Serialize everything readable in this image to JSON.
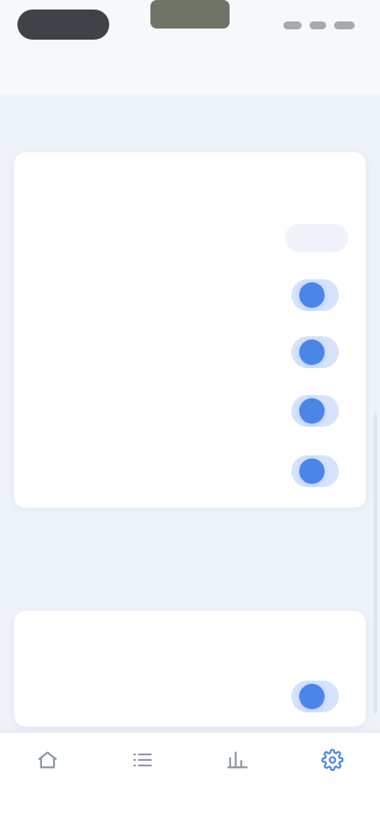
{
  "top": {
    "left_text": "",
    "title": ""
  },
  "sections": {
    "first_header": "",
    "second_header": ""
  },
  "card1": {
    "row1": {
      "label": "",
      "link_value": ""
    },
    "row2": {
      "label": "",
      "segments": [
        "",
        "",
        ""
      ]
    },
    "row3": {
      "label": "",
      "sub": ""
    },
    "row4": {
      "label": "",
      "sub": ""
    },
    "row5": {
      "label": "",
      "sub": ""
    },
    "row6": {
      "label": "",
      "sub": ""
    }
  },
  "footnote": "",
  "card2": {
    "row1": {
      "label": ""
    },
    "row2": {
      "label": ""
    }
  },
  "bottom_nav": {
    "items": [
      {
        "label": "",
        "icon": "home-icon"
      },
      {
        "label": "",
        "icon": "list-icon"
      },
      {
        "label": "",
        "icon": "chart-icon"
      },
      {
        "label": "",
        "icon": "settings-icon",
        "active": true
      }
    ]
  },
  "colors": {
    "accent": "#4a86e8",
    "background": "#eef3fa",
    "card": "#ffffff"
  }
}
